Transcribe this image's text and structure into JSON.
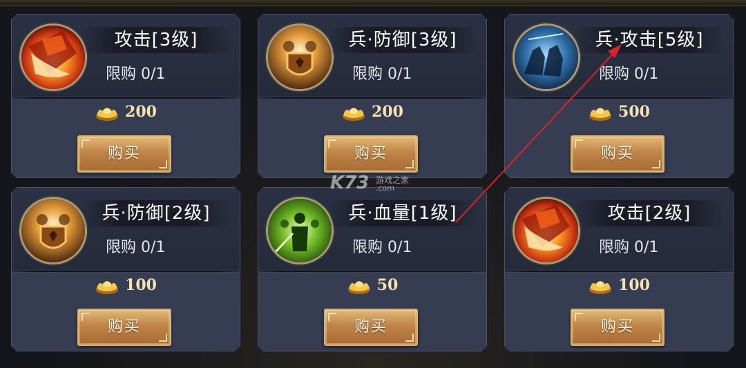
{
  "shop": {
    "items": [
      {
        "title": "攻击[3级]",
        "limit": "限购  0/1",
        "price": "200",
        "buy_label": "购买",
        "icon": "attack-fire-icon"
      },
      {
        "title": "兵·防御[3级]",
        "limit": "限购  0/1",
        "price": "200",
        "buy_label": "购买",
        "icon": "troop-defense-shield-icon"
      },
      {
        "title": "兵·攻击[5级]",
        "limit": "限购  0/1",
        "price": "500",
        "buy_label": "购买",
        "icon": "troop-attack-cavalry-icon"
      },
      {
        "title": "兵·防御[2级]",
        "limit": "限购  0/1",
        "price": "100",
        "buy_label": "购买",
        "icon": "troop-defense-shield-icon"
      },
      {
        "title": "兵·血量[1级]",
        "limit": "限购  0/1",
        "price": "50",
        "buy_label": "购买",
        "icon": "troop-health-soldiers-icon"
      },
      {
        "title": "攻击[2级]",
        "limit": "限购  0/1",
        "price": "100",
        "buy_label": "购买",
        "icon": "attack-fire-icon"
      }
    ],
    "currency_icon": "gold-ingot-icon"
  },
  "watermark": {
    "brand": "K73",
    "site": "游戏之家",
    "domain": ".com"
  },
  "annotation": {
    "color": "#d8242a",
    "icon": "red-arrow-annotation"
  }
}
